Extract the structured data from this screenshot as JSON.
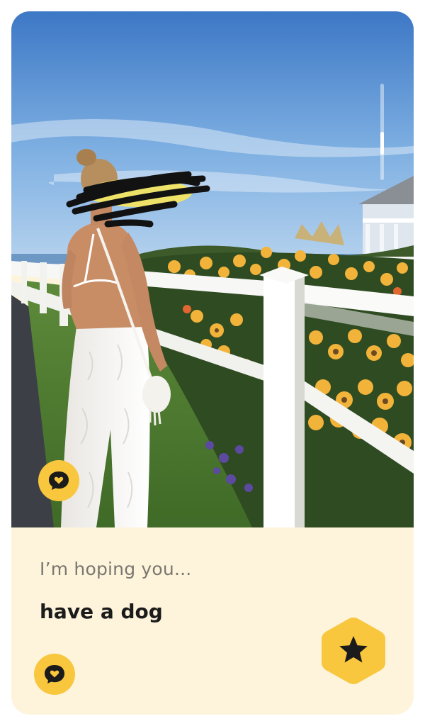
{
  "profile_card": {
    "photo_alt": "Profile photo",
    "prompt": {
      "question": "I’m hoping you...",
      "answer": "have a dog"
    }
  },
  "colors": {
    "accent_yellow": "#f8c73e",
    "prompt_background": "#fdf4db",
    "icon_dark": "#1b1b1b"
  },
  "icons": {
    "comment": "speech-bubble-heart-icon",
    "superlike": "star-icon"
  },
  "scroll_indicator": {
    "position_fraction": 0.65
  }
}
